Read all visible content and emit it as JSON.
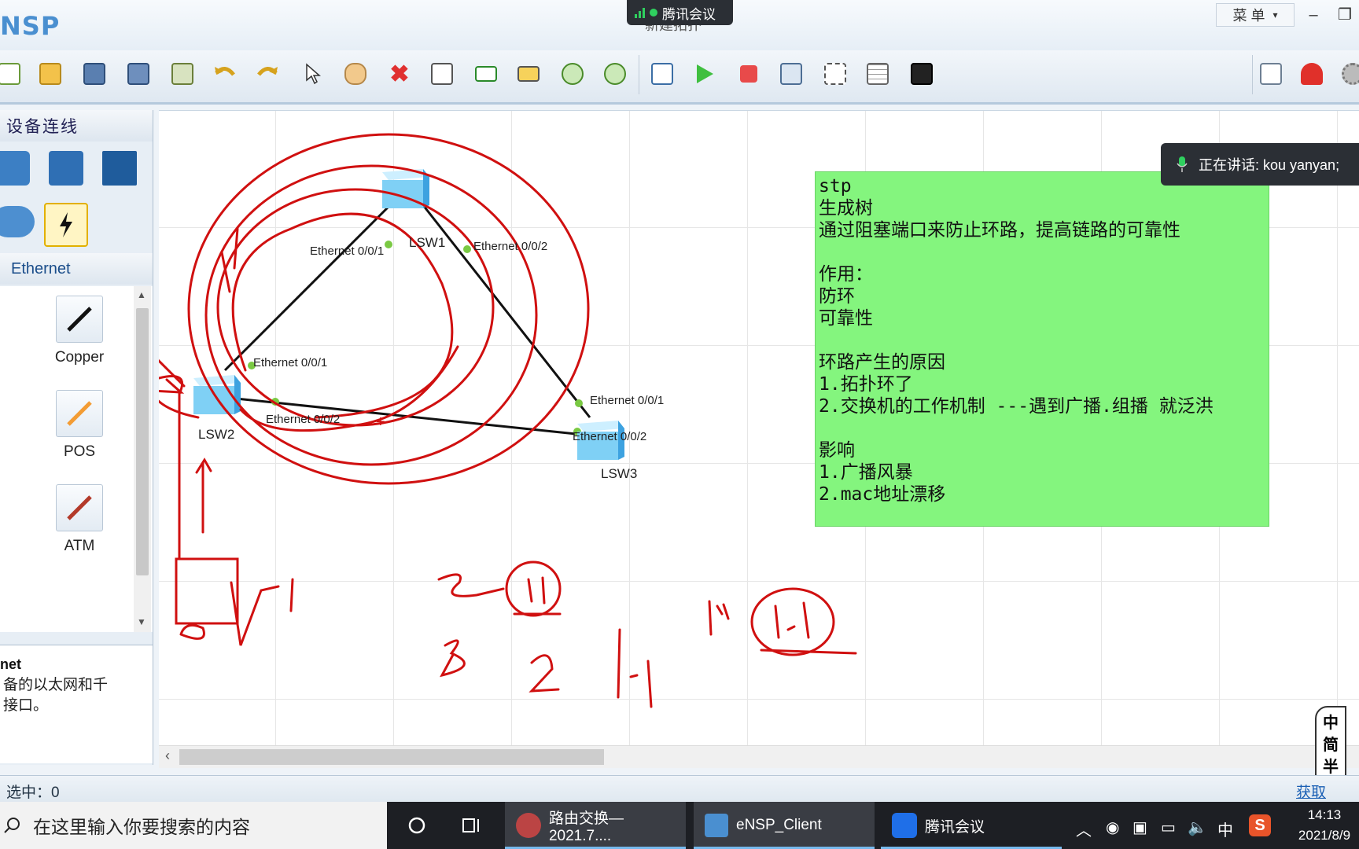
{
  "app": {
    "logo": "NSP",
    "doc_title": "新建拓扑"
  },
  "meeting": {
    "label": "腾讯会议",
    "speaking": "正在讲话: kou yanyan;"
  },
  "titlebar": {
    "menu_label": "菜 单",
    "min": "–",
    "restore": "❐"
  },
  "toolbar_icons": [
    "new-topo",
    "open",
    "save",
    "save-as",
    "print",
    "undo",
    "redo",
    "select",
    "pan",
    "delete",
    "delete-link",
    "text",
    "rect",
    "zoom-in",
    "zoom-out",
    "fit",
    "start",
    "stop",
    "capture",
    "cli",
    "grid",
    "screenshot",
    "chat",
    "huawei",
    "settings"
  ],
  "left_panel": {
    "header": "设备连线",
    "cable_header": "Ethernet",
    "cables": [
      {
        "label": "Copper",
        "color": "#111111"
      },
      {
        "label": "POS",
        "color": "#f39c34"
      },
      {
        "label": "ATM",
        "color": "#c0392b"
      }
    ],
    "desc_title": "net",
    "desc_text": "备的以太网和千\n接口。"
  },
  "topology": {
    "devices": [
      {
        "name": "LSW1"
      },
      {
        "name": "LSW2"
      },
      {
        "name": "LSW3"
      }
    ],
    "ports": [
      "Ethernet 0/0/1",
      "Ethernet 0/0/2",
      "Ethernet 0/0/1",
      "Ethernet 0/0/2",
      "Ethernet 0/0/1",
      "Ethernet 0/0/2"
    ]
  },
  "note": {
    "lines": [
      "stp",
      "生成树",
      "通过阻塞端口来防止环路，提高链路的可靠性",
      "",
      "作用：",
      "防环",
      "可靠性",
      "",
      "环路产生的原因",
      "1.拓扑环了",
      "2.交换机的工作机制 ---遇到广播.组播 就泛洪",
      "",
      "影响",
      "1.广播风暴",
      "2.mac地址漂移"
    ]
  },
  "ime": {
    "chars": [
      "中",
      "简",
      "半",
      "❤"
    ]
  },
  "status": {
    "selected": "选中：0",
    "right_link": "获取"
  },
  "taskbar": {
    "search_placeholder": "在这里输入你要搜索的内容",
    "tasks": [
      {
        "label": "路由交换—2021.7...."
      },
      {
        "label": "eNSP_Client"
      },
      {
        "label": "腾讯会议"
      }
    ],
    "tray_lang": "中",
    "time": "14:13",
    "date": "2021/8/9"
  },
  "colors": {
    "note_bg": "#84f57e",
    "ink": "#d01010",
    "accent": "#1a5fb4"
  }
}
